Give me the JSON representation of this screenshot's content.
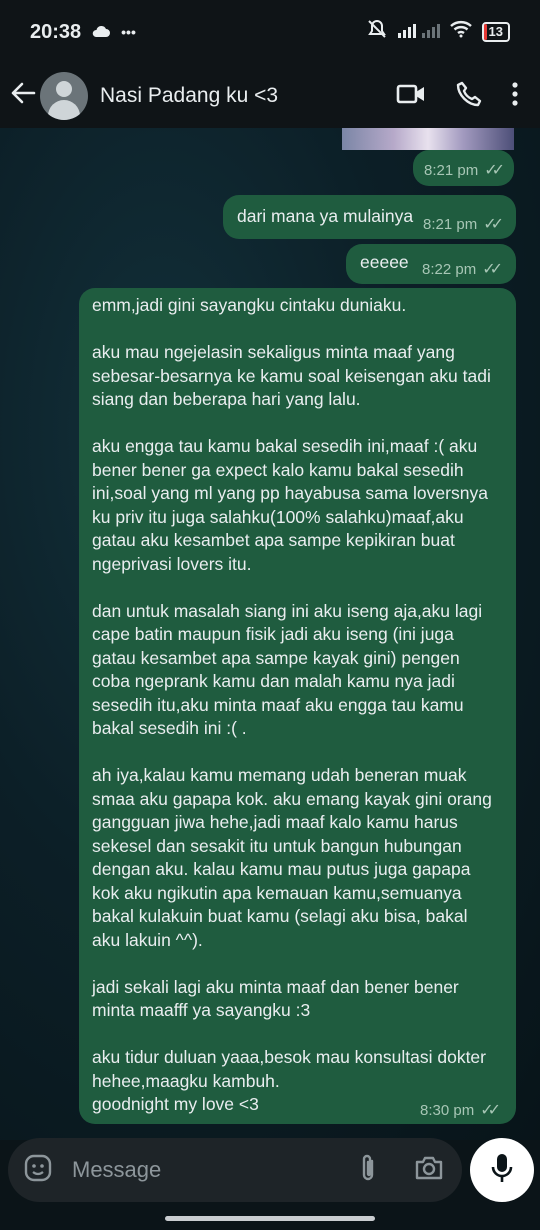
{
  "status_bar": {
    "time": "20:38",
    "dots": "•••",
    "battery": "13"
  },
  "header": {
    "contact_name": "Nasi Padang ku <3"
  },
  "messages": [
    {
      "time": "8:21 pm",
      "text": ""
    },
    {
      "time": "8:21 pm",
      "text": "dari mana ya mulainya"
    },
    {
      "time": "8:22 pm",
      "text": "eeeee"
    },
    {
      "time": "8:30 pm",
      "text": "emm,jadi gini sayangku cintaku duniaku.\n\naku mau ngejelasin sekaligus minta maaf yang sebesar-besarnya ke kamu soal keisengan aku tadi siang dan beberapa hari yang lalu.\n\naku engga tau kamu bakal sesedih ini,maaf :( aku bener bener ga expect kalo kamu bakal sesedih ini,soal yang ml yang pp hayabusa sama loversnya ku priv itu juga salahku(100% salahku)maaf,aku gatau aku kesambet apa sampe kepikiran buat ngeprivasi lovers itu.\n\ndan untuk masalah siang ini aku iseng aja,aku lagi cape batin maupun fisik jadi aku iseng (ini juga gatau kesambet apa sampe kayak gini) pengen coba ngeprank kamu dan malah kamu nya jadi sesedih itu,aku minta maaf aku engga tau kamu bakal sesedih ini :( .\n\nah iya,kalau kamu memang udah beneran muak smaa aku gapapa kok. aku emang kayak gini orang gangguan jiwa hehe,jadi maaf kalo kamu harus sekesel dan sesakit itu untuk bangun hubungan dengan aku. kalau kamu mau putus juga gapapa kok aku ngikutin apa kemauan kamu,semuanya bakal kulakuin buat kamu (selagi aku bisa, bakal aku lakuin ^^).\n\njadi sekali lagi aku minta maaf dan bener bener minta maafff ya sayangku :3\n\naku tidur duluan yaaa,besok mau konsultasi dokter hehee,maagku kambuh.\ngoodnight my love <3"
    }
  ],
  "composer": {
    "placeholder": "Message"
  },
  "colors": {
    "bubble_outgoing": "#1f5c3f",
    "header_bg": "#0f1417",
    "composer_bg": "#1e2428"
  },
  "icons": [
    "cloud-icon",
    "mute-icon",
    "signal-icon",
    "wifi-icon",
    "battery-icon",
    "back-arrow-icon",
    "video-call-icon",
    "phone-icon",
    "more-vert-icon",
    "sticker-icon",
    "attach-icon",
    "camera-icon",
    "mic-icon",
    "double-tick-icon"
  ]
}
